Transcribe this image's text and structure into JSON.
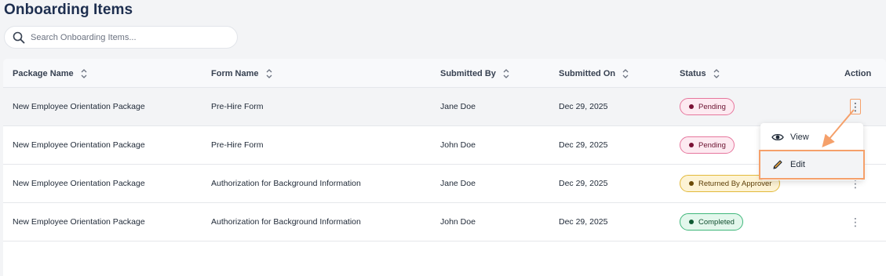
{
  "page": {
    "title": "Onboarding Items"
  },
  "search": {
    "placeholder": "Search Onboarding Items..."
  },
  "table": {
    "headers": {
      "package_name": "Package Name",
      "form_name": "Form Name",
      "submitted_by": "Submitted By",
      "submitted_on": "Submitted On",
      "status": "Status",
      "action": "Action"
    },
    "rows": [
      {
        "package_name": "New Employee Orientation Package",
        "form_name": "Pre-Hire Form",
        "submitted_by": "Jane Doe",
        "submitted_on": "Dec 29, 2025",
        "status": "Pending",
        "status_kind": "pending"
      },
      {
        "package_name": "New Employee Orientation Package",
        "form_name": "Pre-Hire Form",
        "submitted_by": "John Doe",
        "submitted_on": "Dec 29, 2025",
        "status": "Pending",
        "status_kind": "pending"
      },
      {
        "package_name": "New Employee Orientation Package",
        "form_name": "Authorization for Background Information",
        "submitted_by": "Jane Doe",
        "submitted_on": "Dec 29, 2025",
        "status": "Returned By Approver",
        "status_kind": "returned"
      },
      {
        "package_name": "New Employee Orientation Package",
        "form_name": "Authorization for Background Information",
        "submitted_by": "John Doe",
        "submitted_on": "Dec 29, 2025",
        "status": "Completed",
        "status_kind": "completed"
      }
    ]
  },
  "action_menu": {
    "items": [
      {
        "label": "View",
        "icon": "eye-icon"
      },
      {
        "label": "Edit",
        "icon": "pencil-icon"
      }
    ]
  },
  "colors": {
    "title": "#1d2e4f",
    "highlight": "#f5a06a",
    "pending": "#e6769d",
    "returned": "#e2b93b",
    "completed": "#3fb77a"
  }
}
